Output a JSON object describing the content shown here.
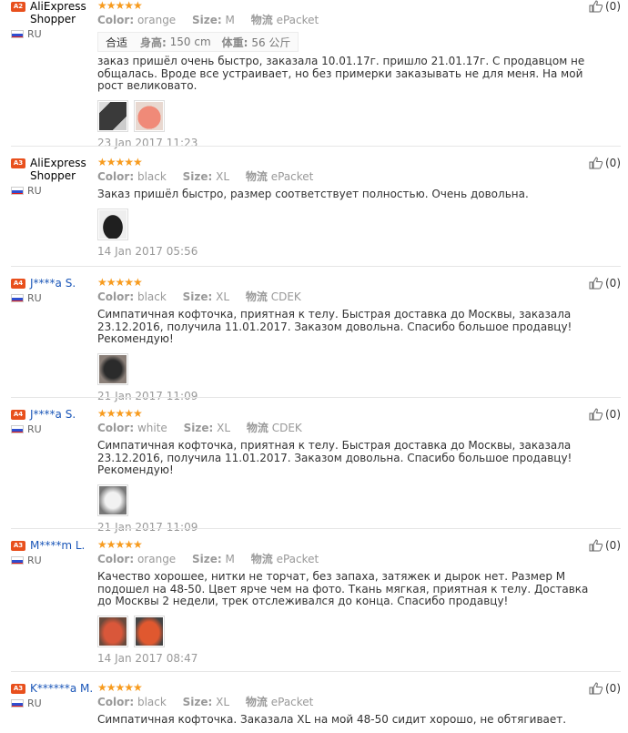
{
  "labels": {
    "color": "Color:",
    "size": "Size:",
    "logistics": "物流"
  },
  "reviews": [
    {
      "badge": "A2",
      "name": "AliExpress Shopper",
      "country": "RU",
      "stars": "★★★★★",
      "color": "orange",
      "size": "M",
      "shipping": "ePacket",
      "fit": {
        "tag": "合适",
        "height_label": "身高:",
        "height": "150 cm",
        "weight_label": "体重:",
        "weight": "56 公斤"
      },
      "text": "заказ пришёл очень быстро, заказала 10.01.17г. пришло 21.01.17г. С продавцом не общалась. Вроде все устраивает, но без примерки заказывать не для меня. На мой рост великовато.",
      "date": "23 Jan 2017 11:23",
      "likes": "(0)",
      "thumbs": [
        "#3a3a3a",
        "#f08a78"
      ]
    },
    {
      "badge": "A3",
      "name": "AliExpress Shopper",
      "country": "RU",
      "stars": "★★★★★",
      "color": "black",
      "size": "XL",
      "shipping": "ePacket",
      "text": "Заказ пришёл быстро, размер соответствует полностью. Очень довольна.",
      "date": "14 Jan 2017 05:56",
      "likes": "(0)",
      "thumbs": [
        "#1f1f1f"
      ]
    },
    {
      "badge": "A4",
      "name": "J****a S.",
      "country": "RU",
      "stars": "★★★★★",
      "color": "black",
      "size": "XL",
      "shipping": "CDEK",
      "text": "Симпатичная кофточка, приятная к телу. Быстрая доставка до Москвы, заказала 23.12.2016, получила 11.01.2017. Заказом довольна. Спасибо большое продавцу! Рекомендую!",
      "date": "21 Jan 2017 11:09",
      "likes": "(0)",
      "thumbs": [
        "#2b2b2b"
      ]
    },
    {
      "badge": "A4",
      "name": "J****a S.",
      "country": "RU",
      "stars": "★★★★★",
      "color": "white",
      "size": "XL",
      "shipping": "CDEK",
      "text": "Симпатичная кофточка, приятная к телу. Быстрая доставка до Москвы, заказала 23.12.2016, получила 11.01.2017. Заказом довольна. Спасибо большое продавцу! Рекомендую!",
      "date": "21 Jan 2017 11:09",
      "likes": "(0)",
      "thumbs": [
        "#d8d8d8"
      ]
    },
    {
      "badge": "A3",
      "name": "M****m L.",
      "country": "RU",
      "stars": "★★★★★",
      "color": "orange",
      "size": "M",
      "shipping": "ePacket",
      "text": "Качество хорошее, нитки не торчат, без запаха, затяжек и дырок нет. Размер М подошел на 48-50. Цвет ярче чем на фото. Ткань мягкая, приятная к телу. Доставка до Москвы 2 недели, трек отслеживался до конца. Спасибо продавцу!",
      "date": "14 Jan 2017 08:47",
      "likes": "(0)",
      "thumbs": [
        "#c0442e",
        "#e0582f"
      ]
    },
    {
      "badge": "A3",
      "name": "K******a M.",
      "country": "RU",
      "stars": "★★★★★",
      "color": "black",
      "size": "XL",
      "shipping": "ePacket",
      "text": "Симпатичная кофточка. Заказала XL на мой 48-50 сидит хорошо, не обтягивает.",
      "likes": "(0)"
    }
  ]
}
